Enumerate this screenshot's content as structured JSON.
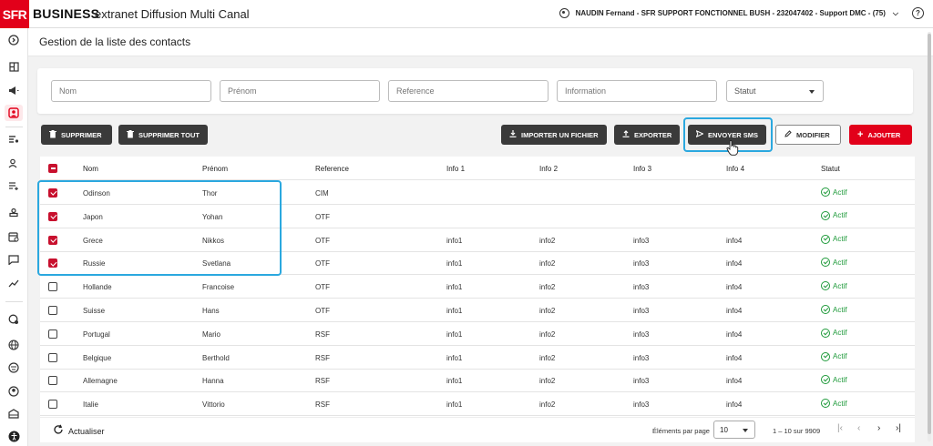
{
  "app": {
    "logo": "SFR",
    "brand": "BUSINESS",
    "title": "extranet Diffusion Multi Canal",
    "user": "NAUDIN Fernand - SFR SUPPORT FONCTIONNEL BUSH - 232047402 - Support DMC - (75)",
    "help": "?"
  },
  "page": {
    "title": "Gestion de la liste des contacts"
  },
  "filters": {
    "nom": "Nom",
    "prenom": "Prénom",
    "reference": "Reference",
    "information": "Information",
    "statut": "Statut"
  },
  "toolbar": {
    "supprimer": "SUPPRIMER",
    "supprimer_tout": "SUPPRIMER TOUT",
    "importer": "IMPORTER UN FICHIER",
    "exporter": "EXPORTER",
    "envoyer_sms": "ENVOYER SMS",
    "modifier": "MODIFIER",
    "ajouter": "AJOUTER"
  },
  "table": {
    "columns": [
      "Nom",
      "Prénom",
      "Reference",
      "Info 1",
      "Info 2",
      "Info 3",
      "Info 4",
      "Statut"
    ],
    "rows": [
      {
        "checked": true,
        "nom": "Odinson",
        "prenom": "Thor",
        "ref": "CIM",
        "info1": "",
        "info2": "",
        "info3": "",
        "info4": "",
        "statut": "Actif"
      },
      {
        "checked": true,
        "nom": "Japon",
        "prenom": "Yohan",
        "ref": "OTF",
        "info1": "",
        "info2": "",
        "info3": "",
        "info4": "",
        "statut": "Actif"
      },
      {
        "checked": true,
        "nom": "Grece",
        "prenom": "Nikkos",
        "ref": "OTF",
        "info1": "info1",
        "info2": "info2",
        "info3": "info3",
        "info4": "info4",
        "statut": "Actif"
      },
      {
        "checked": true,
        "nom": "Russie",
        "prenom": "Svetlana",
        "ref": "OTF",
        "info1": "info1",
        "info2": "info2",
        "info3": "info3",
        "info4": "info4",
        "statut": "Actif"
      },
      {
        "checked": false,
        "nom": "Hollande",
        "prenom": "Francoise",
        "ref": "OTF",
        "info1": "info1",
        "info2": "info2",
        "info3": "info3",
        "info4": "info4",
        "statut": "Actif"
      },
      {
        "checked": false,
        "nom": "Suisse",
        "prenom": "Hans",
        "ref": "OTF",
        "info1": "info1",
        "info2": "info2",
        "info3": "info3",
        "info4": "info4",
        "statut": "Actif"
      },
      {
        "checked": false,
        "nom": "Portugal",
        "prenom": "Mario",
        "ref": "RSF",
        "info1": "info1",
        "info2": "info2",
        "info3": "info3",
        "info4": "info4",
        "statut": "Actif"
      },
      {
        "checked": false,
        "nom": "Belgique",
        "prenom": "Berthold",
        "ref": "RSF",
        "info1": "info1",
        "info2": "info2",
        "info3": "info3",
        "info4": "info4",
        "statut": "Actif"
      },
      {
        "checked": false,
        "nom": "Allemagne",
        "prenom": "Hanna",
        "ref": "RSF",
        "info1": "info1",
        "info2": "info2",
        "info3": "info3",
        "info4": "info4",
        "statut": "Actif"
      },
      {
        "checked": false,
        "nom": "Italie",
        "prenom": "Vittorio",
        "ref": "RSF",
        "info1": "info1",
        "info2": "info2",
        "info3": "info3",
        "info4": "info4",
        "statut": "Actif"
      }
    ]
  },
  "footer": {
    "refresh": "Actualiser",
    "per_page_label": "Éléments par page",
    "per_page_value": "10",
    "range": "1 – 10 sur 9909"
  },
  "colors": {
    "brand_red": "#e2001a",
    "check_red": "#c8102e",
    "status_green": "#1e9a3a",
    "highlight_blue": "#2ba8df",
    "dark_button": "#3a3a3a"
  }
}
